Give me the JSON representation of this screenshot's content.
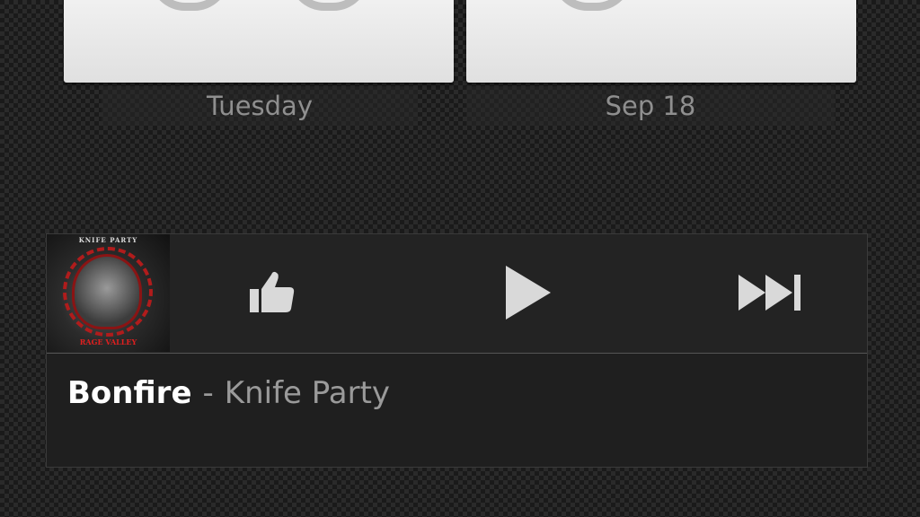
{
  "clock": {
    "day": "Tuesday",
    "date": "Sep 18"
  },
  "music": {
    "track_title": "Bonfire",
    "separator": "-",
    "artist": "Knife Party",
    "album_art": {
      "top_text": "KNIFE PARTY",
      "bottom_text": "RAGE VALLEY"
    },
    "icons": {
      "like": "thumbs-up-icon",
      "play": "play-icon",
      "next": "next-track-icon"
    }
  },
  "colors": {
    "tile": "#eaeaea",
    "icon": "#d9d9d9",
    "accent_red": "#b01c1c"
  }
}
